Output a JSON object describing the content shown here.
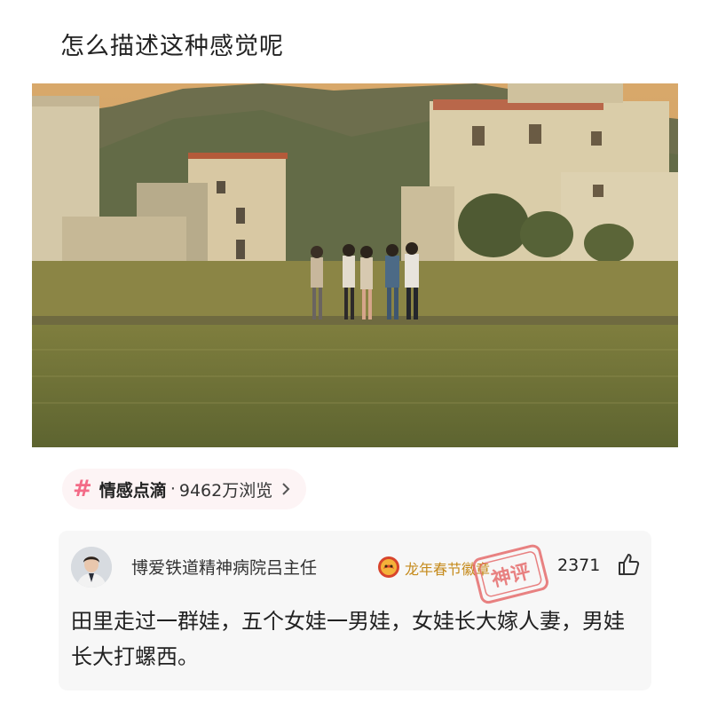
{
  "post": {
    "title": "怎么描述这种感觉呢"
  },
  "topic": {
    "hash_icon": "hash-icon",
    "name": "情感点滴",
    "separator": "·",
    "views": "9462万浏览",
    "accent": "#f36b87"
  },
  "comment": {
    "username": "博爱铁道精神病院吕主任",
    "badge_label": "龙年春节徽章",
    "stamp_text": "神评",
    "likes": "2371",
    "text": "田里走过一群娃，五个女娃一男娃，女娃长大嫁人妻，男娃长大打螺西。"
  },
  "colors": {
    "badge_text": "#c58a1b",
    "stamp": "#e45a5a",
    "card_bg": "#f7f7f7"
  }
}
